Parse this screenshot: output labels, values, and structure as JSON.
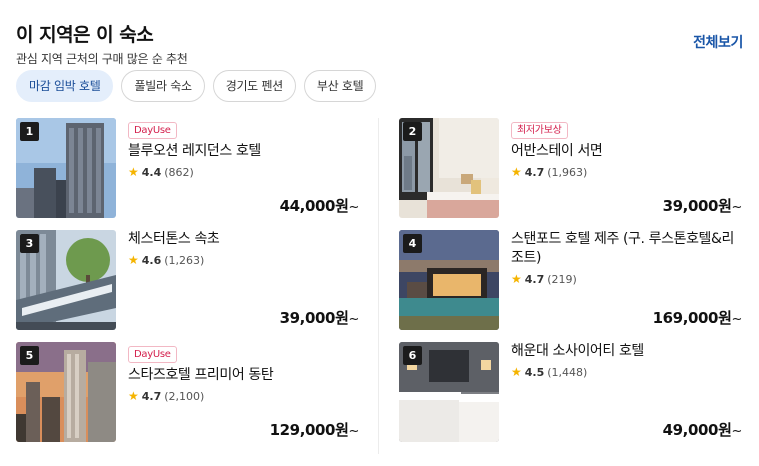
{
  "header": {
    "title": "이 지역은 이 숙소",
    "subtitle": "관심 지역 근처의 구매 많은 순 추천",
    "view_all": "전체보기"
  },
  "chips": [
    {
      "label": "마감 임박 호텔",
      "active": true
    },
    {
      "label": "풀빌라 숙소",
      "active": false
    },
    {
      "label": "경기도 펜션",
      "active": false
    },
    {
      "label": "부산 호텔",
      "active": false
    }
  ],
  "icons": {
    "rating": "star-icon"
  },
  "colors": {
    "accent": "#1a56a8",
    "active_chip_bg": "#e4eefb",
    "badge": "#d4204d",
    "star": "#f5b400"
  },
  "items": [
    {
      "rank": "1",
      "badge": "DayUse",
      "name": "블루오션 레지던스 호텔",
      "score": "4.4",
      "count": "(862)",
      "price": "44,000원",
      "suffix": "~"
    },
    {
      "rank": "2",
      "badge": "최저가보상",
      "name": "어반스테이 서면",
      "score": "4.7",
      "count": "(1,963)",
      "price": "39,000원",
      "suffix": "~"
    },
    {
      "rank": "3",
      "badge": "",
      "name": "체스터톤스 속초",
      "score": "4.6",
      "count": "(1,263)",
      "price": "39,000원",
      "suffix": "~"
    },
    {
      "rank": "4",
      "badge": "",
      "name": "스탠포드 호텔 제주 (구. 루스톤호텔&리조트)",
      "score": "4.7",
      "count": "(219)",
      "price": "169,000원",
      "suffix": "~"
    },
    {
      "rank": "5",
      "badge": "DayUse",
      "name": "스타즈호텔 프리미어 동탄",
      "score": "4.7",
      "count": "(2,100)",
      "price": "129,000원",
      "suffix": "~"
    },
    {
      "rank": "6",
      "badge": "",
      "name": "해운대 소사이어티 호텔",
      "score": "4.5",
      "count": "(1,448)",
      "price": "49,000원",
      "suffix": "~"
    }
  ]
}
